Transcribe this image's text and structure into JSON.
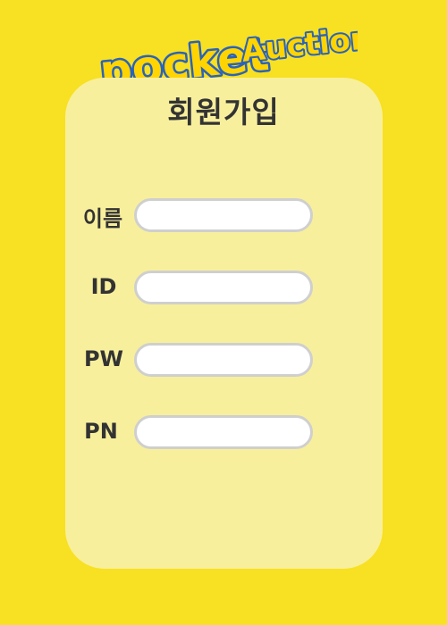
{
  "app": {
    "logo_text_1": "pocket",
    "logo_text_2": "Auction"
  },
  "page": {
    "title": "회원가입"
  },
  "form": {
    "fields": [
      {
        "label": "이름",
        "value": "",
        "placeholder": ""
      },
      {
        "label": "ID",
        "value": "",
        "placeholder": ""
      },
      {
        "label": "PW",
        "value": "",
        "placeholder": ""
      },
      {
        "label": "PN",
        "value": "",
        "placeholder": ""
      }
    ]
  },
  "colors": {
    "background": "#f8e022",
    "card": "#f8ef9c",
    "logo_fill": "#ffd400",
    "logo_outline": "#2b63b8",
    "text": "#333333"
  }
}
